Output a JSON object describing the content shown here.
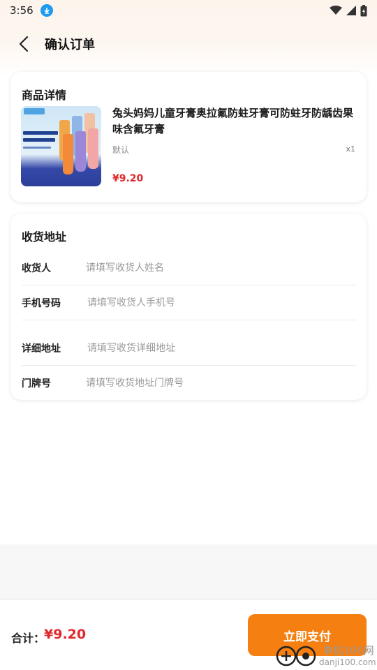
{
  "status_bar": {
    "time": "3:56",
    "icons": [
      "download-icon",
      "wifi-icon",
      "signal-icon",
      "battery-icon"
    ]
  },
  "header": {
    "title": "确认订单",
    "back_icon": "chevron-left-icon"
  },
  "product_section": {
    "title": "商品详情",
    "name": "兔头妈妈儿童牙膏奥拉氟防蛀牙膏可防蛀牙防龋齿果味含氟牙膏",
    "spec": "默认",
    "quantity": "x1",
    "price": "¥9.20"
  },
  "address_section": {
    "title": "收货地址",
    "fields": [
      {
        "label": "收货人",
        "value": "",
        "placeholder": "请填写收货人姓名"
      },
      {
        "label": "手机号码",
        "value": "",
        "placeholder": "请填写收货人手机号"
      },
      {
        "label": "详细地址",
        "value": "",
        "placeholder": "请填写收货详细地址"
      },
      {
        "label": "门牌号",
        "value": "",
        "placeholder": "请填写收货地址门牌号"
      }
    ]
  },
  "footer": {
    "total_label": "合计：",
    "total_value": "¥9.20",
    "pay_label": "立即支付"
  },
  "watermark": {
    "line1": "单机100网",
    "line2": "danji100.com"
  },
  "colors": {
    "accent": "#f57f10",
    "price": "#e0282b",
    "status_download": "#1e9bf0"
  }
}
